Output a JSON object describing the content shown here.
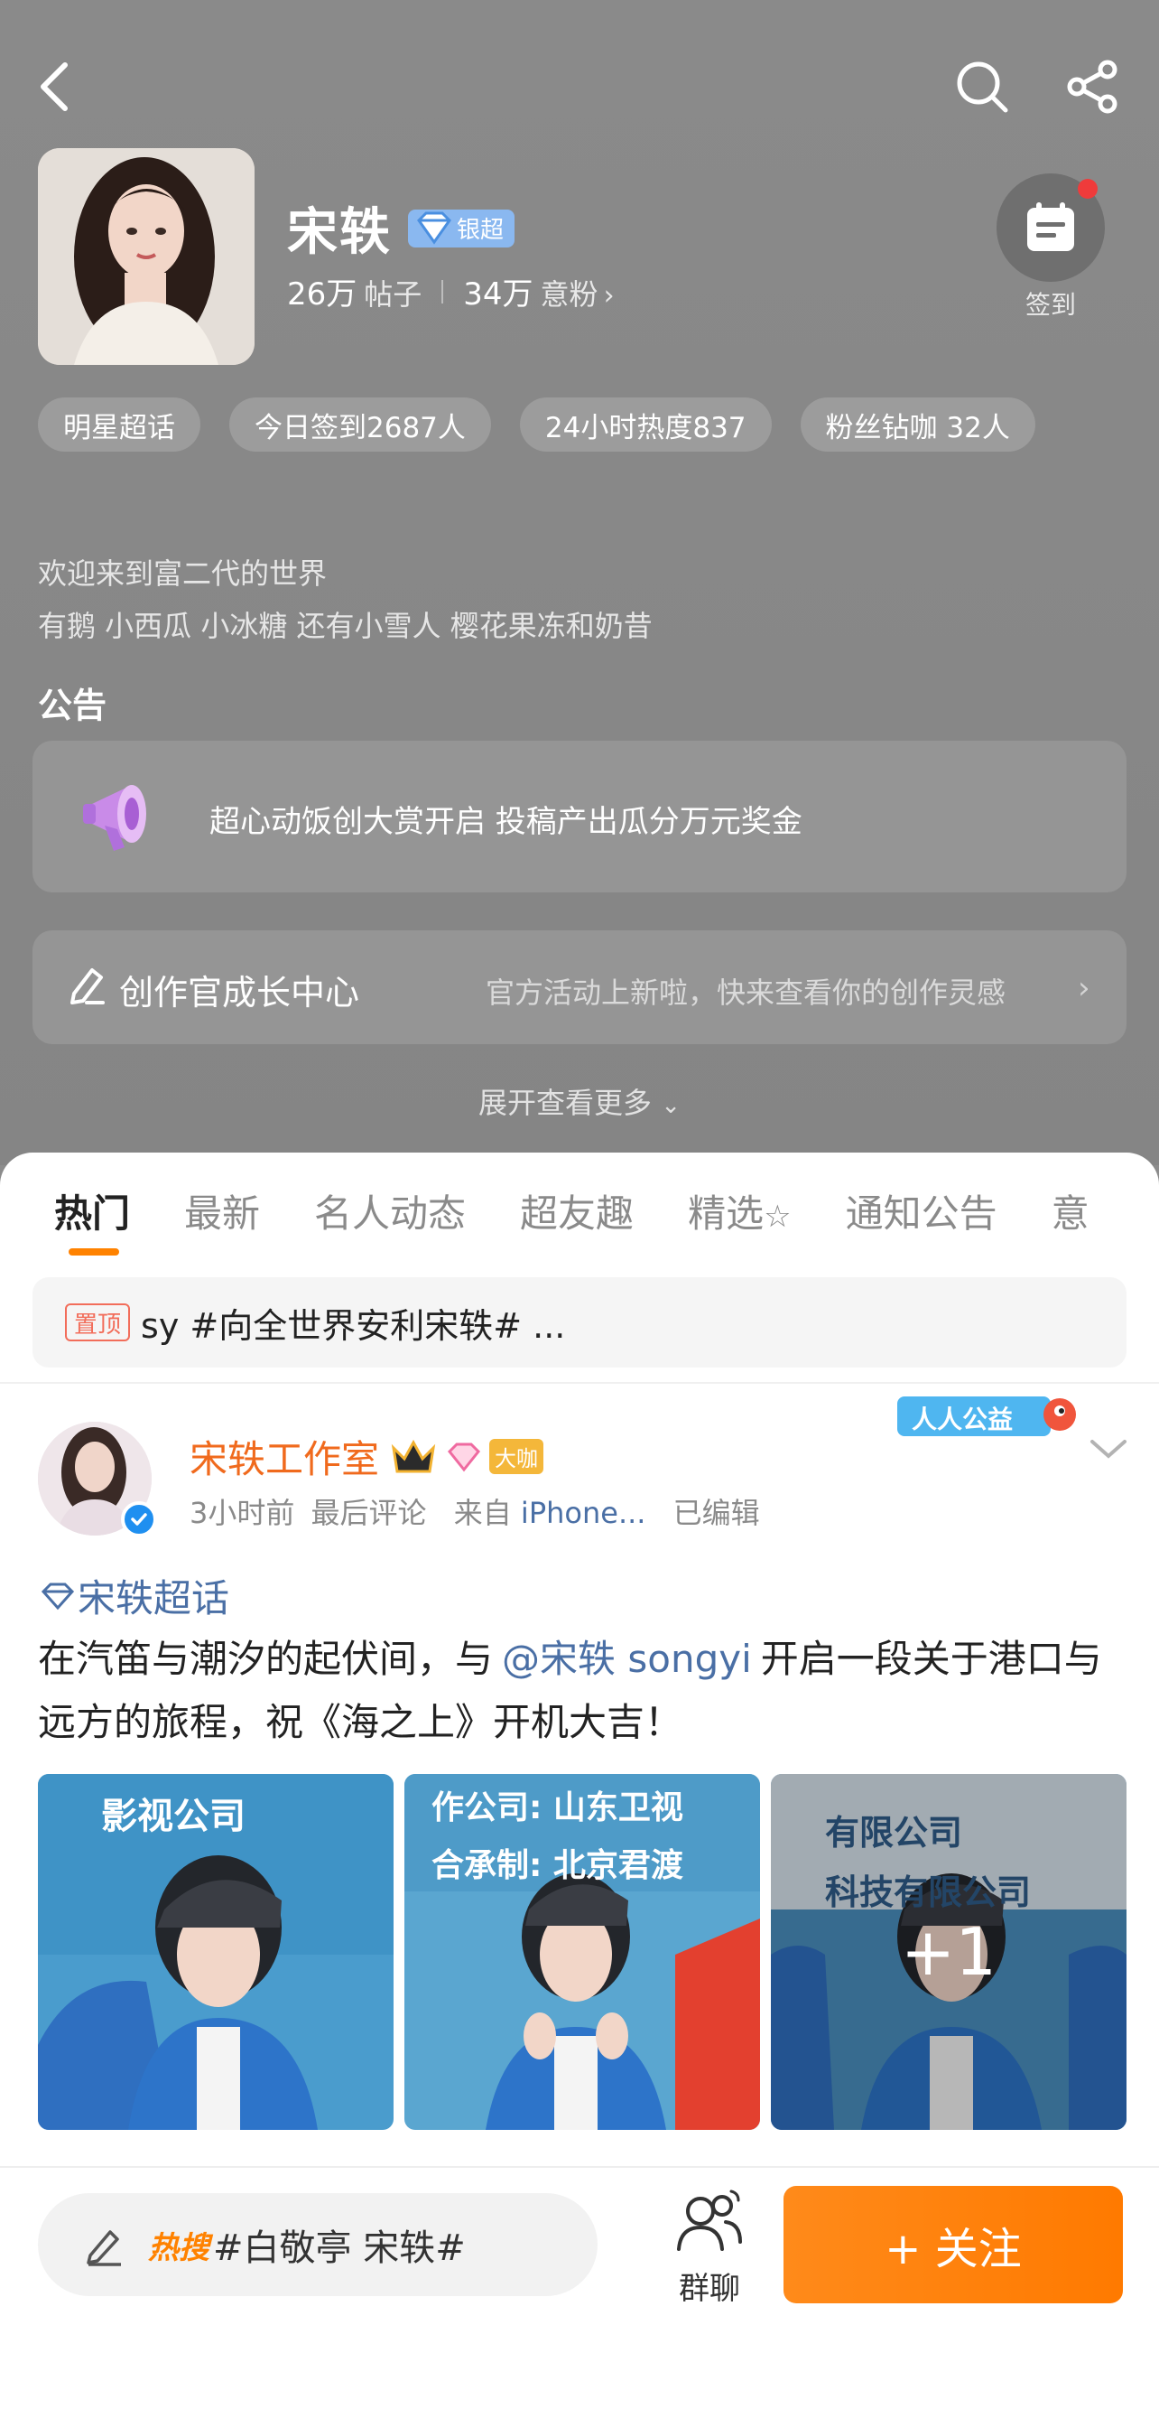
{
  "header": {
    "title": "宋轶",
    "vip_label": "银超",
    "posts_count": "26万",
    "posts_label": "帖子",
    "fans_count": "34万",
    "fans_label": "意粉",
    "signin_label": "签到"
  },
  "tags": [
    "明星超话",
    "今日签到2687人",
    "24小时热度837",
    "粉丝钻咖 32人"
  ],
  "intro": {
    "line1": "欢迎来到富二代的世界",
    "line2": "有鹅 小西瓜 小冰糖 还有小雪人 樱花果冻和奶昔"
  },
  "notice": {
    "title": "公告",
    "text": "超心动饭创大赏开启 投稿产出瓜分万元奖金"
  },
  "creator": {
    "title": "创作官成长中心",
    "subtitle": "官方活动上新啦，快来查看你的创作灵感"
  },
  "expand_label": "展开查看更多",
  "tabs": [
    "热门",
    "最新",
    "名人动态",
    "超友趣",
    "精选",
    "通知公告",
    "意"
  ],
  "pinned": {
    "badge": "置顶",
    "text": "sy #向全世界安利宋轶# ..."
  },
  "post": {
    "author": "宋轶工作室",
    "level_badge": "大咖",
    "charity_label": "人人公益",
    "time": "3小时前",
    "last_comment": "最后评论",
    "source_prefix": "来自",
    "source": "iPhone...",
    "edited": "已编辑",
    "topic": "宋轶超话",
    "body_pre": "在汽笛与潮汐的起伏间，与",
    "mention": "@宋轶 songyi",
    "body_post": "开启一段关于港口与远方的旅程，祝《海之上》开机大吉！",
    "more_count": "+1",
    "img1_text": "影视公司",
    "img2_text1": "作公司: 山东卫视",
    "img2_text2": "合承制: 北京君渡",
    "img3_text1": "有限公司",
    "img3_text2": "科技有限公司"
  },
  "bottom": {
    "hot_label": "热搜",
    "search_text": "#白敬亭 宋轶#",
    "group_chat": "群聊",
    "follow": "+ 关注"
  },
  "colors": {
    "accent": "#ff8200",
    "link": "#4a6fa5",
    "name": "#f06a1d"
  }
}
